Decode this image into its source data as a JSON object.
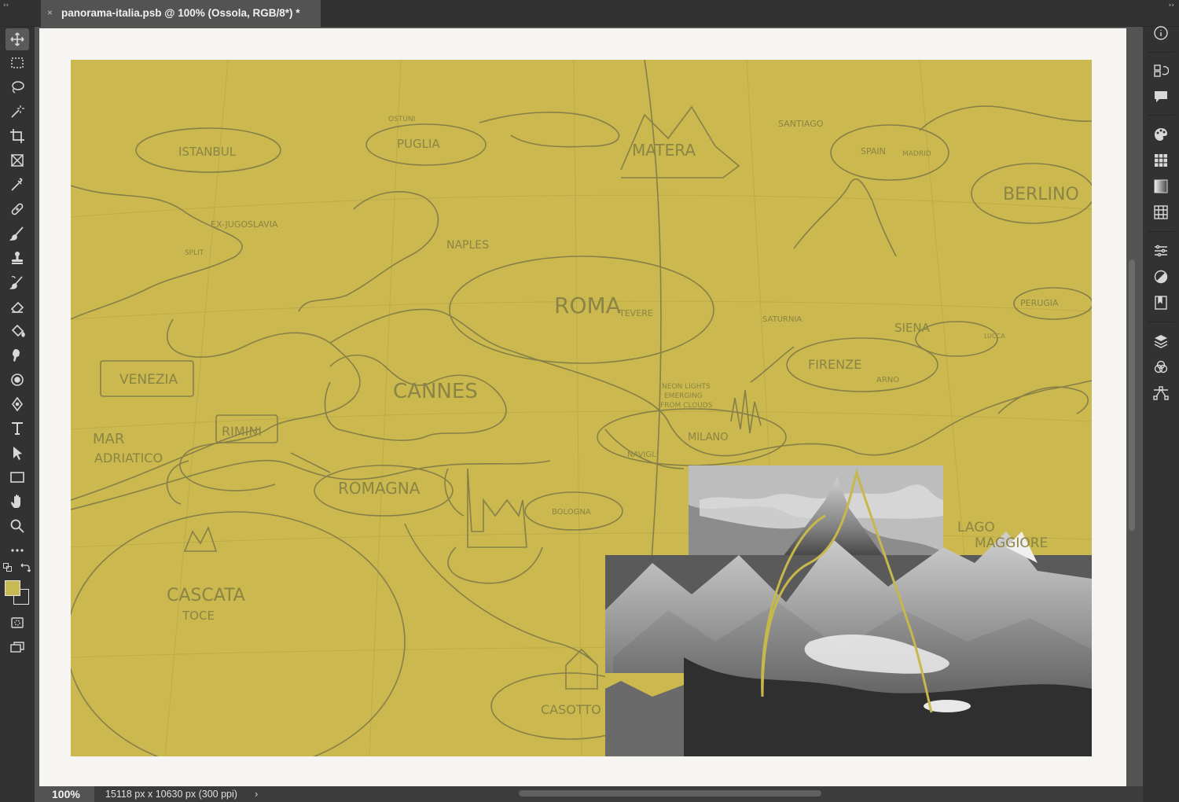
{
  "tab": {
    "title": "panorama-italia.psb @ 100% (Ossola, RGB/8*) *",
    "close_glyph": "×",
    "collapse_glyph": "››"
  },
  "status": {
    "zoom": "100%",
    "doc_info": "15118 px x 10630 px (300 ppi)",
    "arrow": "›"
  },
  "colors": {
    "foreground": "#c8b950",
    "background": "#323232",
    "canvas_fill": "#cbb84f"
  },
  "tools": [
    "move-tool-icon",
    "rectangular-marquee-icon",
    "lasso-icon",
    "magic-wand-icon",
    "crop-icon",
    "frame-icon",
    "eyedropper-icon",
    "healing-brush-icon",
    "brush-icon",
    "clone-stamp-icon",
    "history-brush-icon",
    "eraser-icon",
    "paint-bucket-icon",
    "smudge-icon",
    "dodge-icon",
    "pen-icon",
    "type-icon",
    "path-selection-icon",
    "rectangle-icon",
    "hand-icon",
    "zoom-icon",
    "more-tools-icon"
  ],
  "panels": [
    "info-icon",
    "history-icon",
    "comments-icon",
    "color-icon",
    "swatches-icon",
    "gradients-icon",
    "patterns-icon",
    "properties-icon",
    "adjustments-icon",
    "libraries-icon",
    "layers-icon",
    "channels-icon",
    "paths-icon"
  ],
  "sketch_labels": {
    "istanbul": "ISTANBUL",
    "puglia": "PUGLIA",
    "ostuni": "OSTUNI",
    "matera": "MATERA",
    "santiago": "SANTIAGO",
    "spain": "SPAIN",
    "madrid": "MADRID",
    "berlino": "BERLINO",
    "ex_jugoslavia": "EX-JUGOSLAVIA",
    "split": "SPLIT",
    "naples": "NAPLES",
    "roma": "ROMA",
    "tevere": "TEVERE",
    "saturnia": "SATURNIA",
    "siena": "SIENA",
    "perugia": "PERUGIA",
    "venezia": "VENEZIA",
    "cannes": "CANNES",
    "firenze": "FIRENZE",
    "arno": "ARNO",
    "neon": "NEON LIGHTS",
    "emerging": "EMERGING",
    "clouds": "FROM CLOUDS",
    "milano": "MILANO",
    "navigli": "NAVIGLI",
    "mar": "MAR",
    "adriatico": "ADRIATICO",
    "rimini": "RIMINI",
    "romagna": "ROMAGNA",
    "bologna": "BOLOGNA",
    "cascata": "CASCATA",
    "toce": "TOCE",
    "casotto": "CASOTTO",
    "lago": "LAGO",
    "maggiore": "MAGGIORE",
    "lucca": "LUCCA"
  }
}
